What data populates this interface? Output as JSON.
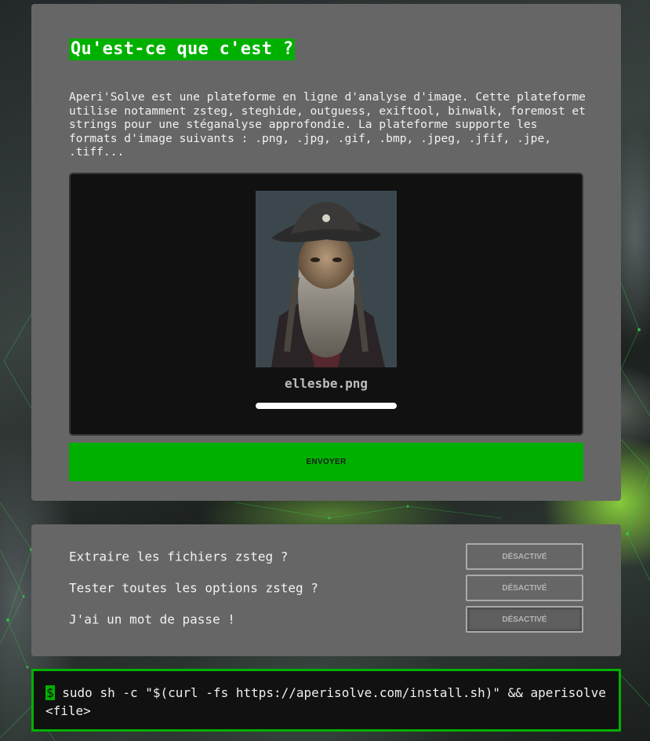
{
  "intro": {
    "title": "Qu'est-ce que c'est ?",
    "description": "Aperi'Solve est une plateforme en ligne d'analyse d'image. Cette plateforme utilise notamment zsteg, steghide, outguess, exiftool, binwalk, foremost et strings pour une stéganalyse approfondie. La plateforme supporte les formats d'image suivants : .png, .jpg, .gif, .bmp, .jpeg, .jfif, .jpe, .tiff...",
    "upload": {
      "file_name": "ellesbe.png",
      "progress": 1.0,
      "preview_icon": "pirate-portrait-image"
    },
    "send_label": "ENVOYER"
  },
  "options": [
    {
      "label": "Extraire les fichiers zsteg ?",
      "state": "DÉSACTIVÉ"
    },
    {
      "label": "Tester toutes les options zsteg ?",
      "state": "DÉSACTIVÉ"
    },
    {
      "label": "J'ai un mot de passe !",
      "state": "DÉSACTIVÉ"
    }
  ],
  "terminal": {
    "prompt": "$",
    "command": " sudo sh -c \"$(curl -fs https://aperisolve.com/install.sh)\" && aperisolve <file>"
  },
  "colors": {
    "accent": "#00b000",
    "card": "#666666",
    "terminal_bg": "#111111"
  }
}
